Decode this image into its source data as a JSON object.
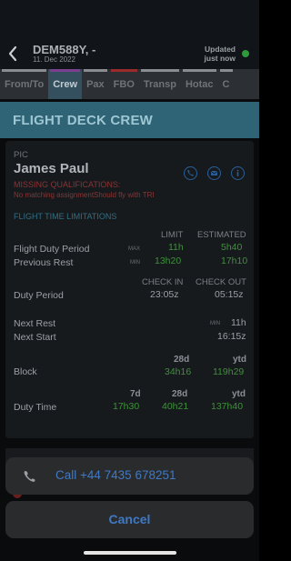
{
  "header": {
    "flight_code": "DEM588Y, -",
    "date": "11. Dec 2022",
    "updated_line1": "Updated",
    "updated_line2": "just now",
    "status_color": "#2e9a3b"
  },
  "tabs": [
    {
      "label": "From/To",
      "color": "#8a8d90",
      "active": false
    },
    {
      "label": "Crew",
      "color": "#7a3f8f",
      "active": true
    },
    {
      "label": "Pax",
      "color": "#8a8d90",
      "active": false
    },
    {
      "label": "FBO",
      "color": "#9a2b2b",
      "active": false
    },
    {
      "label": "Transp",
      "color": "#8a8d90",
      "active": false
    },
    {
      "label": "Hotac",
      "color": "#8a8d90",
      "active": false
    },
    {
      "label": "C",
      "color": "#8a8d90",
      "active": false
    }
  ],
  "section": {
    "title": "FLIGHT DECK CREW"
  },
  "crew_member": {
    "role": "PIC",
    "name": "James Paul",
    "missing_title": "MISSING QUALIFICATIONS:",
    "missing_detail": "No matching assignmentShould fly with TRI",
    "icons": [
      "phone-icon",
      "email-icon",
      "info-icon"
    ]
  },
  "ftl": {
    "title": "FLIGHT TIME LIMITATIONS",
    "limit_header": "LIMIT",
    "estimated_header": "ESTIMATED",
    "flight_duty_label": "Flight Duty Period",
    "flight_duty_qualifier": "MAX",
    "flight_duty_limit": "11h",
    "flight_duty_estimated": "5h40",
    "previous_rest_label": "Previous Rest",
    "previous_rest_qualifier": "MIN",
    "previous_rest_limit": "13h20",
    "previous_rest_estimated": "17h10",
    "check_in_header": "CHECK IN",
    "check_out_header": "CHECK OUT",
    "duty_period_label": "Duty Period",
    "check_in": "23:05z",
    "check_out": "05:15z",
    "next_rest_label": "Next Rest",
    "next_rest_qualifier": "MIN",
    "next_rest_value": "11h",
    "next_start_label": "Next Start",
    "next_start_value": "16:15z",
    "block_label": "Block",
    "block_28d_header": "28d",
    "block_ytd_header": "ytd",
    "block_28d": "34h16",
    "block_ytd": "119h29",
    "duty_label": "Duty Time",
    "duty_7d_header": "7d",
    "duty_28d_header": "28d",
    "duty_ytd_header": "ytd",
    "duty_7d": "17h30",
    "duty_28d": "40h21",
    "duty_ytd": "137h40"
  },
  "action_sheet": {
    "call_label": "Call +44 7435 678251",
    "cancel_label": "Cancel"
  }
}
